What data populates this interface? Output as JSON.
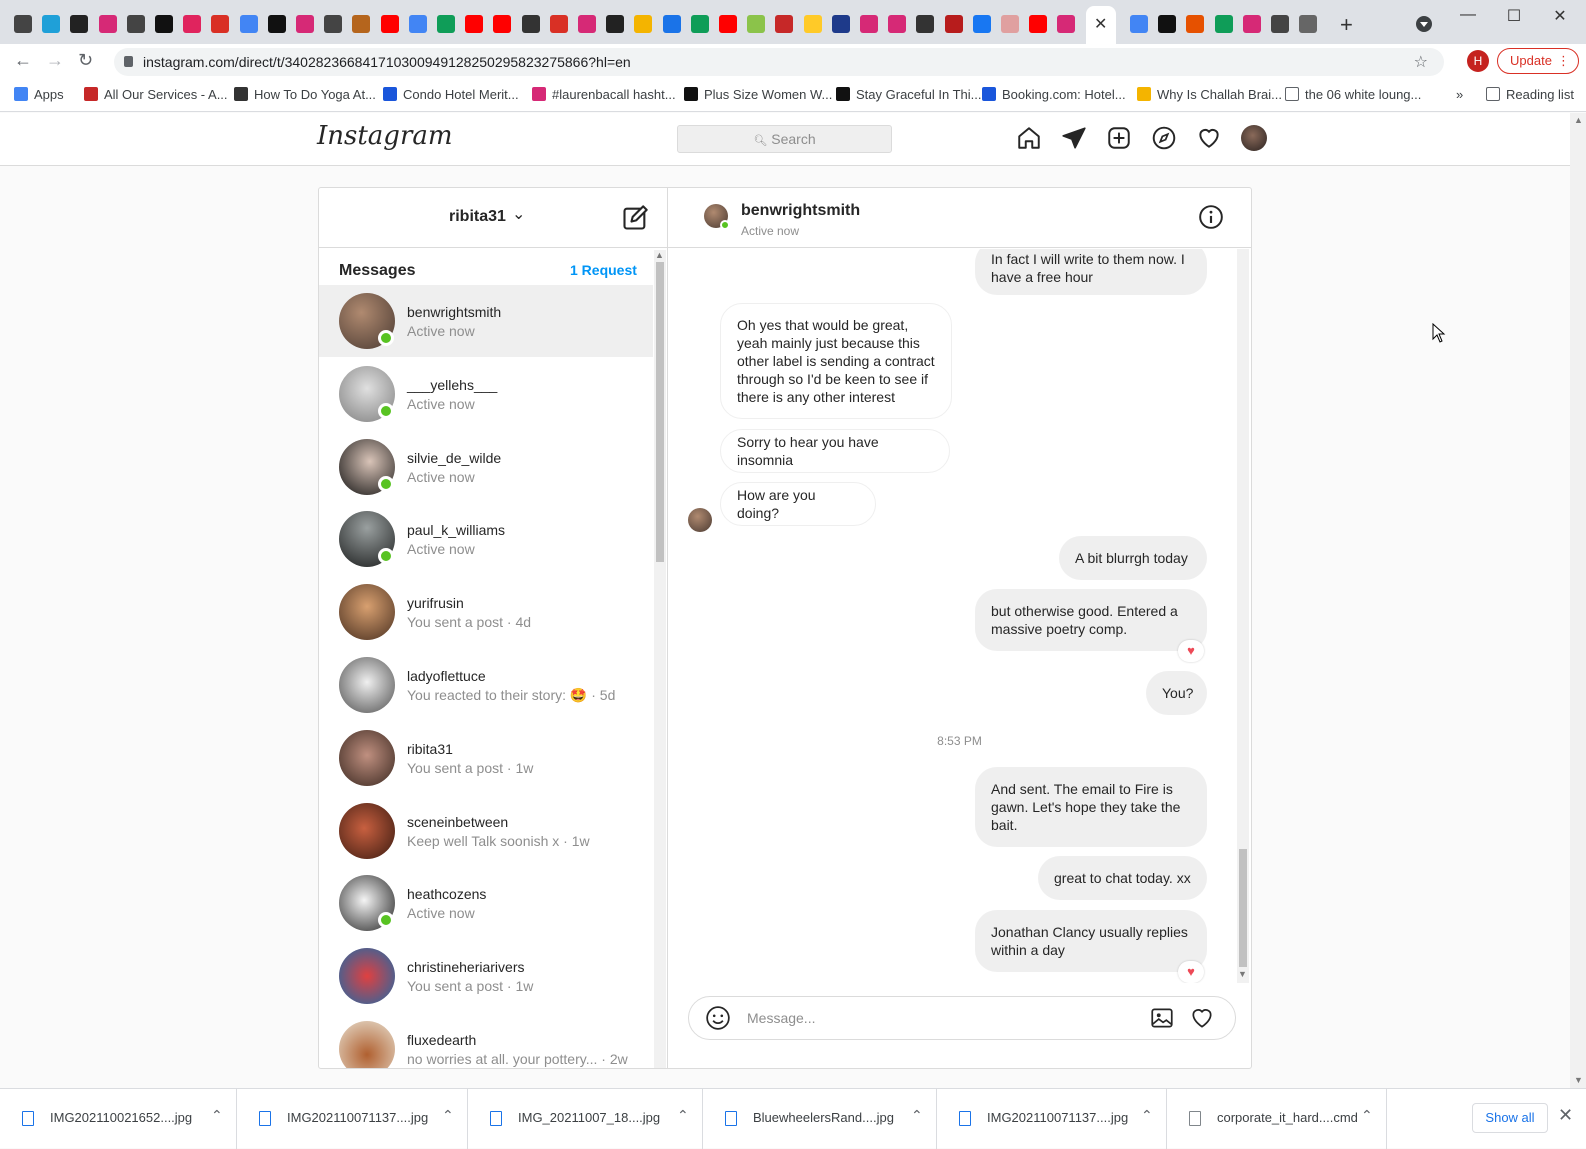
{
  "browser": {
    "url": "instagram.com/direct/t/340282366841710300949128250295823275866?hl=en",
    "profile_initial": "H",
    "update_label": "Update",
    "new_tab_symbol": "+",
    "bookmarks": [
      {
        "label": "Apps",
        "icon": "apps-grid-icon"
      },
      {
        "label": "All Our Services - A...",
        "icon": "services-icon"
      },
      {
        "label": "How To Do Yoga At...",
        "icon": "v-logo-icon"
      },
      {
        "label": "Condo Hotel Merit...",
        "icon": "booking-b-icon"
      },
      {
        "label": "#laurenbacall hasht...",
        "icon": "instagram-icon"
      },
      {
        "label": "Plus Size Women W...",
        "icon": "b-logo-icon"
      },
      {
        "label": "Stay Graceful In Thi...",
        "icon": "b-logo-icon"
      },
      {
        "label": "Booking.com: Hotel...",
        "icon": "booking-b-icon"
      },
      {
        "label": "Why Is Challah Brai...",
        "icon": "candle-icon"
      },
      {
        "label": "the 06 white loung...",
        "icon": "page-icon"
      }
    ],
    "bookmarks_more": "»",
    "reading_list": "Reading list"
  },
  "instagram": {
    "logo": "Instagram",
    "search_placeholder": "Search",
    "account": "ribita31",
    "messages_title": "Messages",
    "requests": "1 Request",
    "conversations": [
      {
        "username": "benwrightsmith",
        "status": "Active now",
        "online": true,
        "active": true
      },
      {
        "username": "___yellehs___",
        "status": "Active now",
        "online": true
      },
      {
        "username": "silvie_de_wilde",
        "status": "Active now",
        "online": true
      },
      {
        "username": "paul_k_williams",
        "status": "Active now",
        "online": true
      },
      {
        "username": "yurifrusin",
        "status": "You sent a post · 4d",
        "online": false
      },
      {
        "username": "ladyoflettuce",
        "status": "You reacted to their story: 🤩 · 5d",
        "online": false
      },
      {
        "username": "ribita31",
        "status": "You sent a post · 1w",
        "online": false
      },
      {
        "username": "sceneinbetween",
        "status": "Keep well Talk soonish x · 1w",
        "online": false
      },
      {
        "username": "heathcozens",
        "status": "Active now",
        "online": true
      },
      {
        "username": "christineheriarivers",
        "status": "You sent a post · 1w",
        "online": false
      },
      {
        "username": "fluxedearth",
        "status": "no worries at all. your pottery... · 2w",
        "online": false
      }
    ],
    "chat": {
      "name": "benwrightsmith",
      "status": "Active now",
      "messages": [
        {
          "text": "In fact I will write to them now. I have a free hour",
          "dir": "out"
        },
        {
          "text": "Oh yes that would be great, yeah mainly just because this other label is sending a contract through so I'd be keen to see if there is any other interest",
          "dir": "in"
        },
        {
          "text": "Sorry to hear you have insomnia",
          "dir": "in"
        },
        {
          "text": "How are you doing?",
          "dir": "in"
        },
        {
          "text": "A bit blurrgh today",
          "dir": "out"
        },
        {
          "text": "but otherwise good. Entered a massive poetry comp.",
          "dir": "out",
          "reaction": "heart"
        },
        {
          "text": "You?",
          "dir": "out"
        },
        {
          "text": "And sent. The email to Fire is gawn. Let's hope they take the bait.",
          "dir": "out"
        },
        {
          "text": "great to chat today. xx",
          "dir": "out"
        },
        {
          "text": "Jonathan Clancy usually replies within a day",
          "dir": "out",
          "reaction": "heart"
        }
      ],
      "timestamp": "8:53 PM",
      "composer_placeholder": "Message..."
    }
  },
  "downloads": {
    "files": [
      "IMG202110021652....jpg",
      "IMG202110071137....jpg",
      "IMG_20211007_18....jpg",
      "BluewheelersRand....jpg",
      "IMG202110071137....jpg",
      "corporate_it_hard....cmd"
    ],
    "show_all": "Show all"
  },
  "colors": {
    "accent": "#0095f6",
    "online": "#58c322",
    "heart": "#ed4956",
    "update": "#d93025"
  }
}
